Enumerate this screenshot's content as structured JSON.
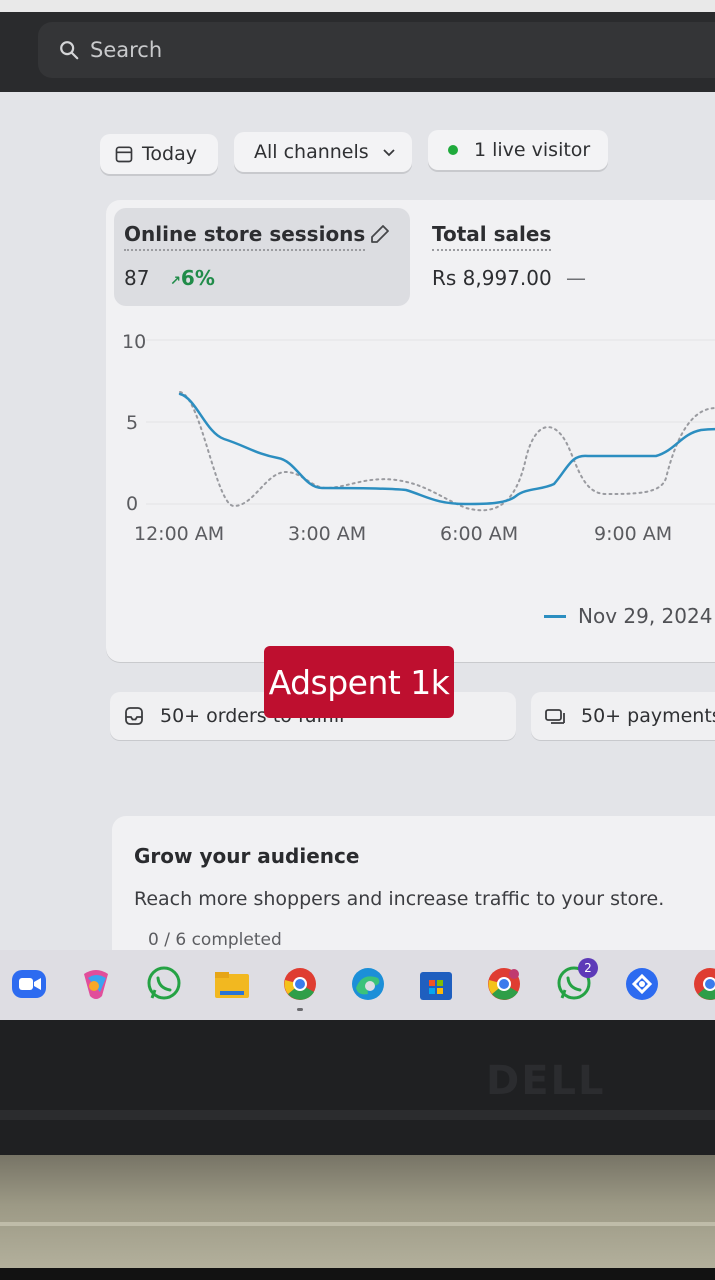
{
  "search": {
    "placeholder": "Search"
  },
  "filters": {
    "date_label": "Today",
    "channel_label": "All channels",
    "live_visitors_label": "1 live visitor"
  },
  "metrics": {
    "sessions": {
      "label": "Online store sessions",
      "value": "87",
      "change": "6%"
    },
    "sales": {
      "label": "Total sales",
      "value": "Rs 8,997.00",
      "change": "—"
    }
  },
  "chart_data": {
    "type": "line",
    "x": [
      "12:00 AM",
      "3:00 AM",
      "6:00 AM",
      "9:00 AM"
    ],
    "y_ticks": [
      0,
      5,
      10
    ],
    "ylim": [
      0,
      10
    ],
    "series": [
      {
        "name": "Nov 29, 2024",
        "style": "solid",
        "color": "#2c8ec0"
      },
      {
        "style": "dotted",
        "color": "#9a9ba0"
      }
    ],
    "legend": "bottom-right"
  },
  "actions": {
    "orders_label": "50+ orders to fulfill",
    "payments_label": "50+ payments"
  },
  "overlay_text": "Adspent 1k",
  "audience": {
    "title": "Grow your audience",
    "description": "Reach more shoppers and increase traffic to your store.",
    "progress": "0 / 6 completed"
  },
  "taskbar": {
    "icons": [
      "zoom-icon",
      "copilot-icon",
      "whatsapp-icon",
      "file-explorer-icon",
      "chrome-icon",
      "edge-icon",
      "microsoft-store-icon",
      "chrome-profile-icon",
      "whatsapp-beta-icon",
      "chrome-remote-icon",
      "chrome-partial-icon"
    ],
    "whatsapp_badge": "2"
  },
  "brand": "DELL"
}
